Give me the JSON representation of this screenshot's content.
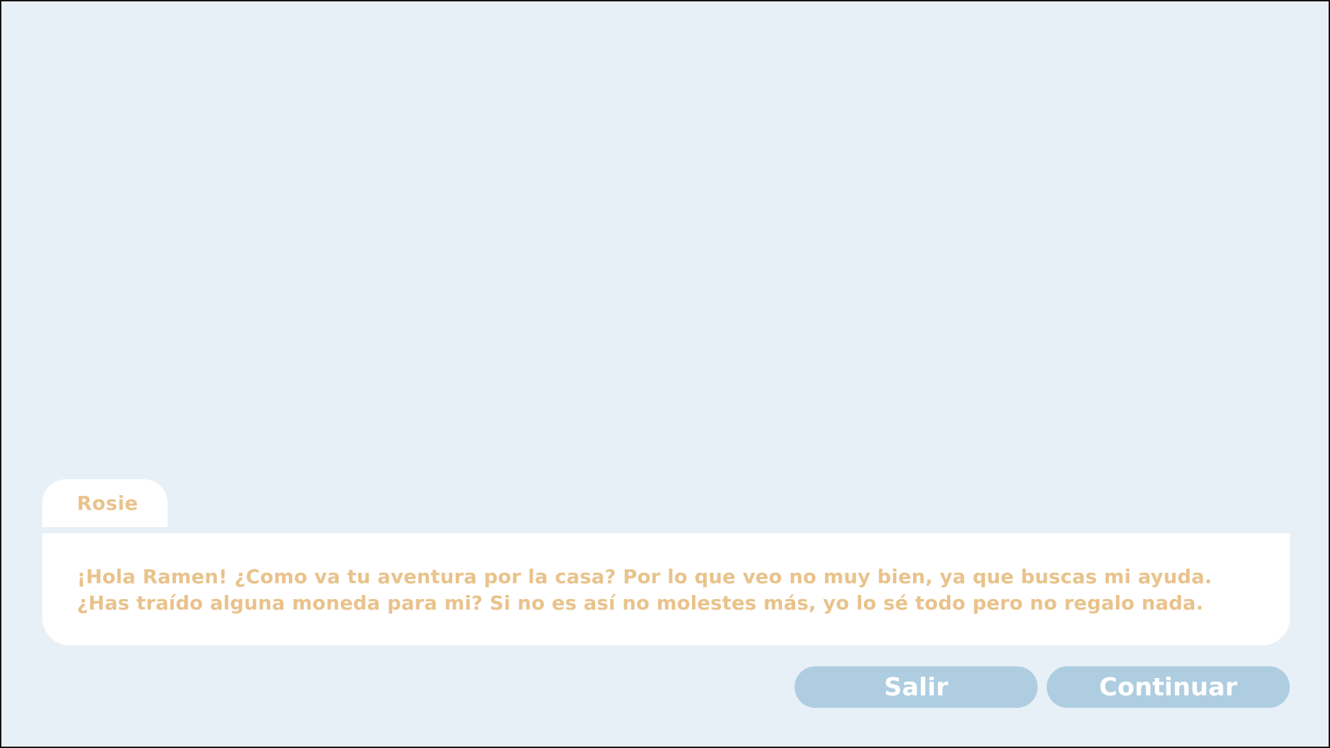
{
  "dialog": {
    "speaker": "Rosie",
    "text": "¡Hola Ramen! ¿Como va tu aventura por la casa? Por lo que veo no muy bien, ya que buscas mi ayuda. ¿Has traído alguna moneda para mi? Si no es así no molestes más, yo lo sé todo pero no regalo nada."
  },
  "buttons": {
    "exit_label": "Salir",
    "continue_label": "Continuar"
  },
  "colors": {
    "background": "#e8f0f7",
    "dialog_text": "#e9c38c",
    "button_fill": "#aecde0",
    "button_text": "#ffffff"
  }
}
